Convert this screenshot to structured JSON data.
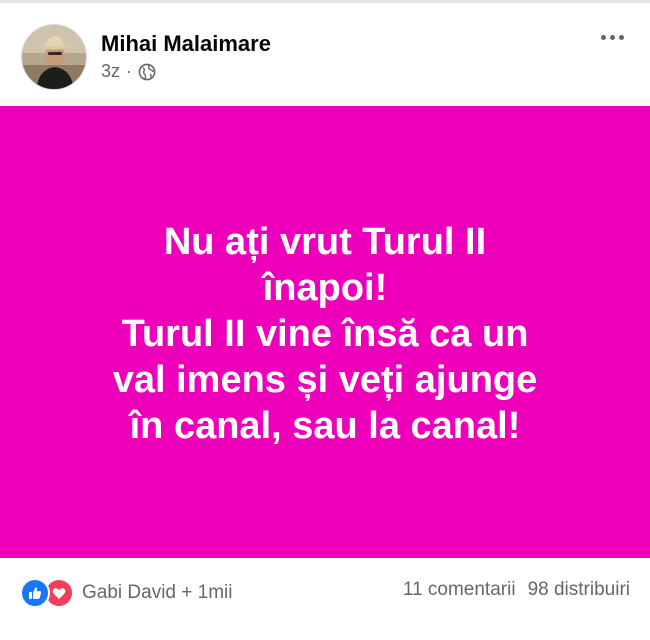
{
  "post": {
    "author": "Mihai Malaimare",
    "time": "3z",
    "separator": "·",
    "privacy_icon": "globe-icon",
    "more_icon": "more-options-icon"
  },
  "banner": {
    "background_color": "#ee00bb",
    "text_color": "#ffffff",
    "lines": [
      "Nu ați vrut Turul II",
      "înapoi!",
      "Turul II vine însă ca un",
      "val imens și veți ajunge",
      "în canal, sau la canal!"
    ]
  },
  "footer": {
    "reaction_icons": [
      "like-icon",
      "love-icon"
    ],
    "reaction_names": "Gabi David + 1mii",
    "comments": "11 comentarii",
    "shares": "98 distribuiri"
  },
  "colors": {
    "like": "#1877f2",
    "love": "#f33e58",
    "muted_text": "#65676b"
  }
}
